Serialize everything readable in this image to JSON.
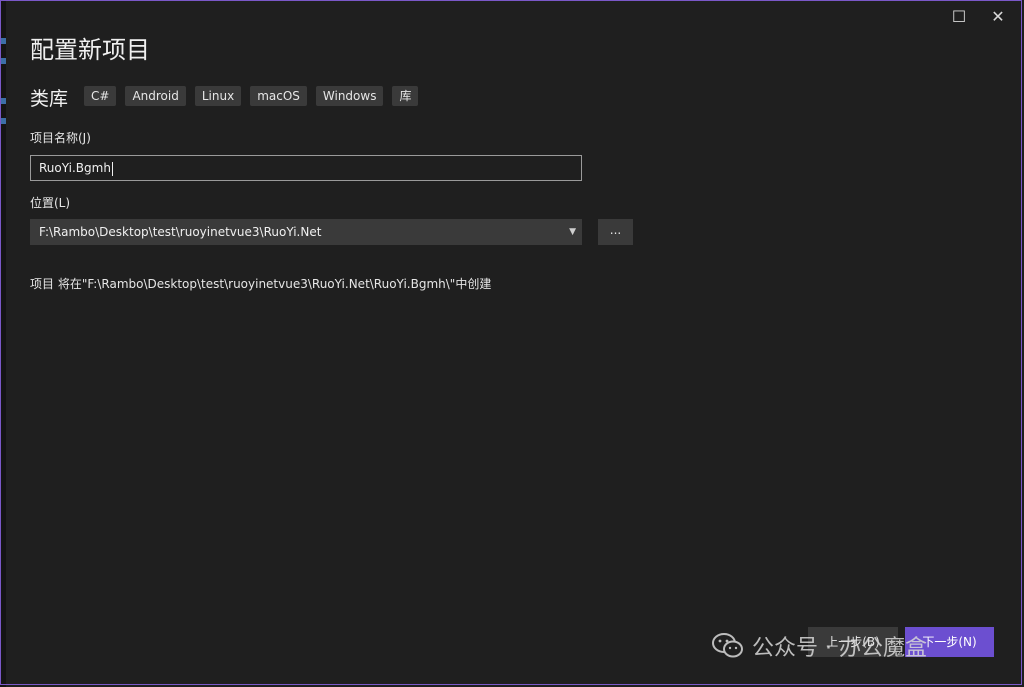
{
  "window": {
    "maximize_glyph": "☐",
    "close_glyph": "✕"
  },
  "page": {
    "title": "配置新项目",
    "template_name": "类库",
    "tags": [
      "C#",
      "Android",
      "Linux",
      "macOS",
      "Windows",
      "库"
    ]
  },
  "form": {
    "project_name_label": "项目名称(J)",
    "project_name_value": "RuoYi.Bgmh",
    "location_label": "位置(L)",
    "location_value": "F:\\Rambo\\Desktop\\test\\ruoyinetvue3\\RuoYi.Net",
    "browse_label": "...",
    "info_text": "项目 将在\"F:\\Rambo\\Desktop\\test\\ruoyinetvue3\\RuoYi.Net\\RuoYi.Bgmh\\\"中创建"
  },
  "footer": {
    "back_label": "上一步(B)",
    "next_label": "下一步(N)"
  },
  "watermark": {
    "text": "公众号 · 办公魔盒"
  },
  "colors": {
    "background": "#1f1f1f",
    "accent": "#6c4fd0",
    "control": "#3a3a3a"
  }
}
